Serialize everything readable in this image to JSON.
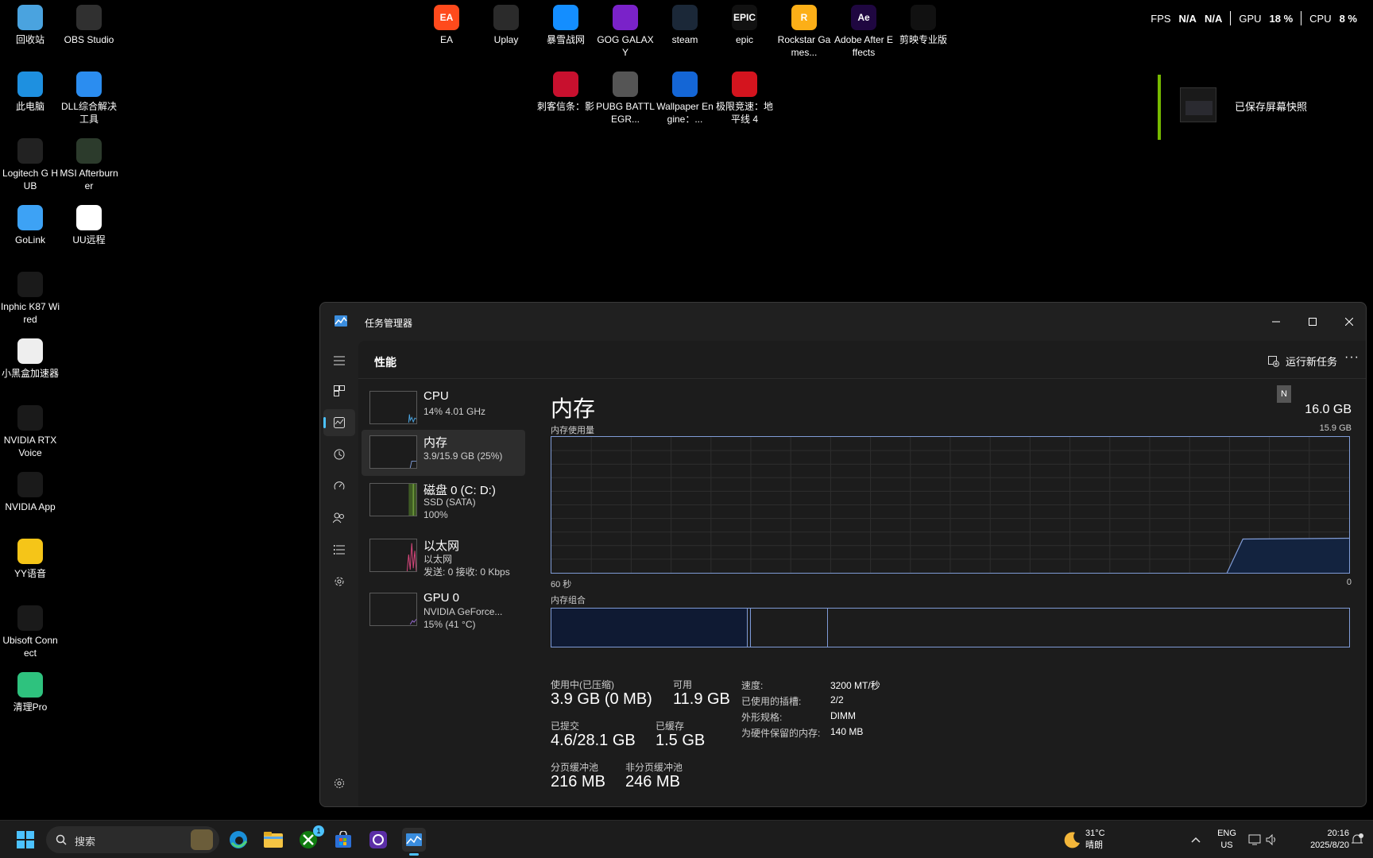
{
  "desktop": {
    "left_icons": [
      {
        "label": "回收站",
        "icon": "recycle-bin-icon",
        "color": "#4aa3df"
      },
      {
        "label": "OBS Studio",
        "icon": "obs-icon",
        "color": "#303030"
      },
      {
        "label": "此电脑",
        "icon": "this-pc-icon",
        "color": "#1e90e0"
      },
      {
        "label": "DLL综合解决工具",
        "icon": "cloud-icon",
        "color": "#2b8df0"
      },
      {
        "label": "Logitech G HUB",
        "icon": "logitech-icon",
        "color": "#222"
      },
      {
        "label": "MSI Afterburner",
        "icon": "msi-icon",
        "color": "#2c3b2c"
      },
      {
        "label": "GoLink",
        "icon": "golink-icon",
        "color": "#3da2f5"
      },
      {
        "label": "UU远程",
        "icon": "uu-remote-icon",
        "color": "#fff"
      },
      {
        "label": "Inphic K87 Wired",
        "icon": "keyboard-icon",
        "color": "#1a1a1a"
      },
      {
        "label": "小黑盒加速器",
        "icon": "accelerator-icon",
        "color": "#eee"
      },
      {
        "label": "NVIDIA RTX Voice",
        "icon": "headset-icon",
        "color": "#1a1a1a"
      },
      {
        "label": "NVIDIA App",
        "icon": "nvidia-icon",
        "color": "#1a1a1a"
      },
      {
        "label": "YY语音",
        "icon": "yy-icon",
        "color": "#f5c518"
      },
      {
        "label": "Ubisoft Connect",
        "icon": "ubisoft-icon",
        "color": "#1a1a1a"
      },
      {
        "label": "清理Pro",
        "icon": "cleaner-icon",
        "color": "#2ec27e"
      }
    ],
    "top_icons": [
      {
        "label": "EA",
        "icon": "ea-icon",
        "color": "#ff4a1c",
        "text": "EA"
      },
      {
        "label": "Uplay",
        "icon": "uplay-icon",
        "color": "#2b2b2b",
        "text": ""
      },
      {
        "label": "暴雪战网",
        "icon": "battlenet-icon",
        "color": "#148eff",
        "text": ""
      },
      {
        "label": "GOG GALAXY",
        "icon": "gog-icon",
        "color": "#7a22c9",
        "text": ""
      },
      {
        "label": "steam",
        "icon": "steam-icon",
        "color": "#1b2838",
        "text": ""
      },
      {
        "label": "epic",
        "icon": "epic-icon",
        "color": "#111",
        "text": "EPIC"
      },
      {
        "label": "Rockstar Games...",
        "icon": "rockstar-icon",
        "color": "#fcaf17",
        "text": "R"
      },
      {
        "label": "Adobe After Effects",
        "icon": "after-effects-icon",
        "color": "#1f0740",
        "text": "Ae"
      },
      {
        "label": "剪映专业版",
        "icon": "capcut-icon",
        "color": "#111",
        "text": ""
      },
      {
        "label": "刺客信条：影",
        "icon": "assassins-creed-icon",
        "color": "#c8102e",
        "text": ""
      },
      {
        "label": "PUBG BATTLEGR...",
        "icon": "pubg-icon",
        "color": "#555",
        "text": ""
      },
      {
        "label": "Wallpaper Engine：...",
        "icon": "wallpaper-engine-icon",
        "color": "#1466d6",
        "text": ""
      },
      {
        "label": "极限竞速：地平线 4",
        "icon": "forza-icon",
        "color": "#d4141e",
        "text": ""
      }
    ]
  },
  "overlay": {
    "fps_label": "FPS",
    "fps_value1": "N/A",
    "fps_value2": "N/A",
    "gpu_label": "GPU",
    "gpu_value": "18 %",
    "cpu_label": "CPU",
    "cpu_value": "8 %"
  },
  "toast": {
    "text": "已保存屏幕快照",
    "accent": "#76b900"
  },
  "task_manager": {
    "title": "任务管理器",
    "page_title": "性能",
    "run_new_task": "运行新任务",
    "devices": [
      {
        "name": "CPU",
        "sub1": "14% 4.01 GHz",
        "sub2": "",
        "sub3": ""
      },
      {
        "name": "内存",
        "sub1": "3.9/15.9 GB (25%)",
        "sub2": "",
        "sub3": ""
      },
      {
        "name": "磁盘 0 (C: D:)",
        "sub1": "SSD (SATA)",
        "sub2": "100%",
        "sub3": ""
      },
      {
        "name": "以太网",
        "sub1": "以太网",
        "sub2": "发送: 0 接收: 0 Kbps",
        "sub3": ""
      },
      {
        "name": "GPU 0",
        "sub1": "NVIDIA GeForce...",
        "sub2": "15% (41 °C)",
        "sub3": ""
      }
    ],
    "detail": {
      "title": "内存",
      "total": "16.0 GB",
      "badge": "N",
      "usage_label": "内存使用量",
      "max_label": "15.9 GB",
      "time_left": "60 秒",
      "time_right": "0",
      "composition_label": "内存组合",
      "in_use_label": "使用中(已压缩)",
      "in_use_value": "3.9 GB (0 MB)",
      "available_label": "可用",
      "available_value": "11.9 GB",
      "committed_label": "已提交",
      "committed_value": "4.6/28.1 GB",
      "cached_label": "已缓存",
      "cached_value": "1.5 GB",
      "paged_label": "分页缓冲池",
      "paged_value": "216 MB",
      "nonpaged_label": "非分页缓冲池",
      "nonpaged_value": "246 MB",
      "speed_label": "速度:",
      "speed_value": "3200 MT/秒",
      "slots_label": "已使用的插槽:",
      "slots_value": "2/2",
      "form_label": "外形规格:",
      "form_value": "DIMM",
      "reserved_label": "为硬件保留的内存:",
      "reserved_value": "140 MB"
    }
  },
  "taskbar": {
    "search_placeholder": "搜索",
    "xbox_badge": "1",
    "weather_temp": "31°C",
    "weather_desc": "晴朗",
    "lang1": "ENG",
    "lang2": "US",
    "time": "20:16",
    "date": "2025/8/20"
  }
}
